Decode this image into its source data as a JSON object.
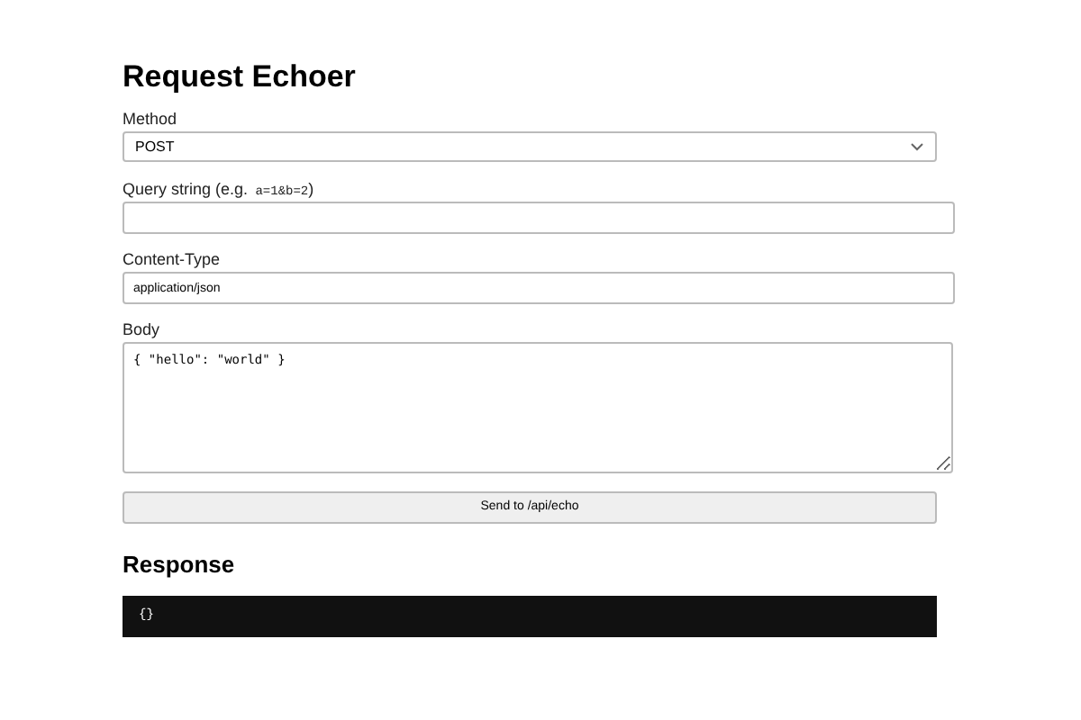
{
  "title": "Request Echoer",
  "fields": [
    {
      "kind": "select",
      "label": "Method",
      "value": "POST"
    },
    {
      "kind": "input",
      "label": "Query string (e.g.",
      "label_code": "a=1&b=2",
      "label_suffix": ")"
    },
    {
      "kind": "input",
      "label": "Content-Type",
      "value": "application/json"
    },
    {
      "kind": "textarea",
      "label": "Body",
      "value": "{ \"hello\": \"world\" }"
    }
  ],
  "send_button": "Send to /api/echo",
  "response": {
    "heading": "Response",
    "output": "{}"
  }
}
